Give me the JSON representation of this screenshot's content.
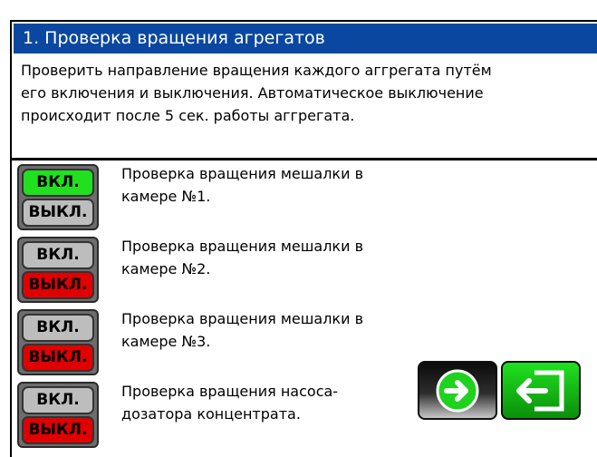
{
  "header": {
    "title": "1. Проверка вращения агрегатов"
  },
  "description": {
    "lines": [
      "Проверить направление вращения каждого аггрегата путём",
      "его включения и выключения. Автоматическое выключение",
      "происходит после 5 сек. работы аггрегата."
    ]
  },
  "rows": [
    {
      "on_label": "ВКЛ.",
      "off_label": "ВЫКЛ.",
      "state": "on",
      "text": [
        "Проверка вращения мешалки в",
        "камере №1."
      ]
    },
    {
      "on_label": "ВКЛ.",
      "off_label": "ВЫКЛ.",
      "state": "off",
      "text": [
        "Проверка вращения мешалки в",
        "камере №2."
      ]
    },
    {
      "on_label": "ВКЛ.",
      "off_label": "ВЫКЛ.",
      "state": "off",
      "text": [
        "Проверка вращения мешалки в",
        "камере №3."
      ]
    },
    {
      "on_label": "ВКЛ.",
      "off_label": "ВЫКЛ.",
      "state": "off",
      "text": [
        "Проверка вращения насоса-",
        "дозатора концентрата."
      ]
    }
  ],
  "colors": {
    "title_bg": "#0a47a0",
    "on_active": "#20e020",
    "off_active": "#e10000",
    "inactive": "#bdbdbd"
  },
  "icons": {
    "next": "arrow-right-icon",
    "exit": "exit-icon"
  }
}
